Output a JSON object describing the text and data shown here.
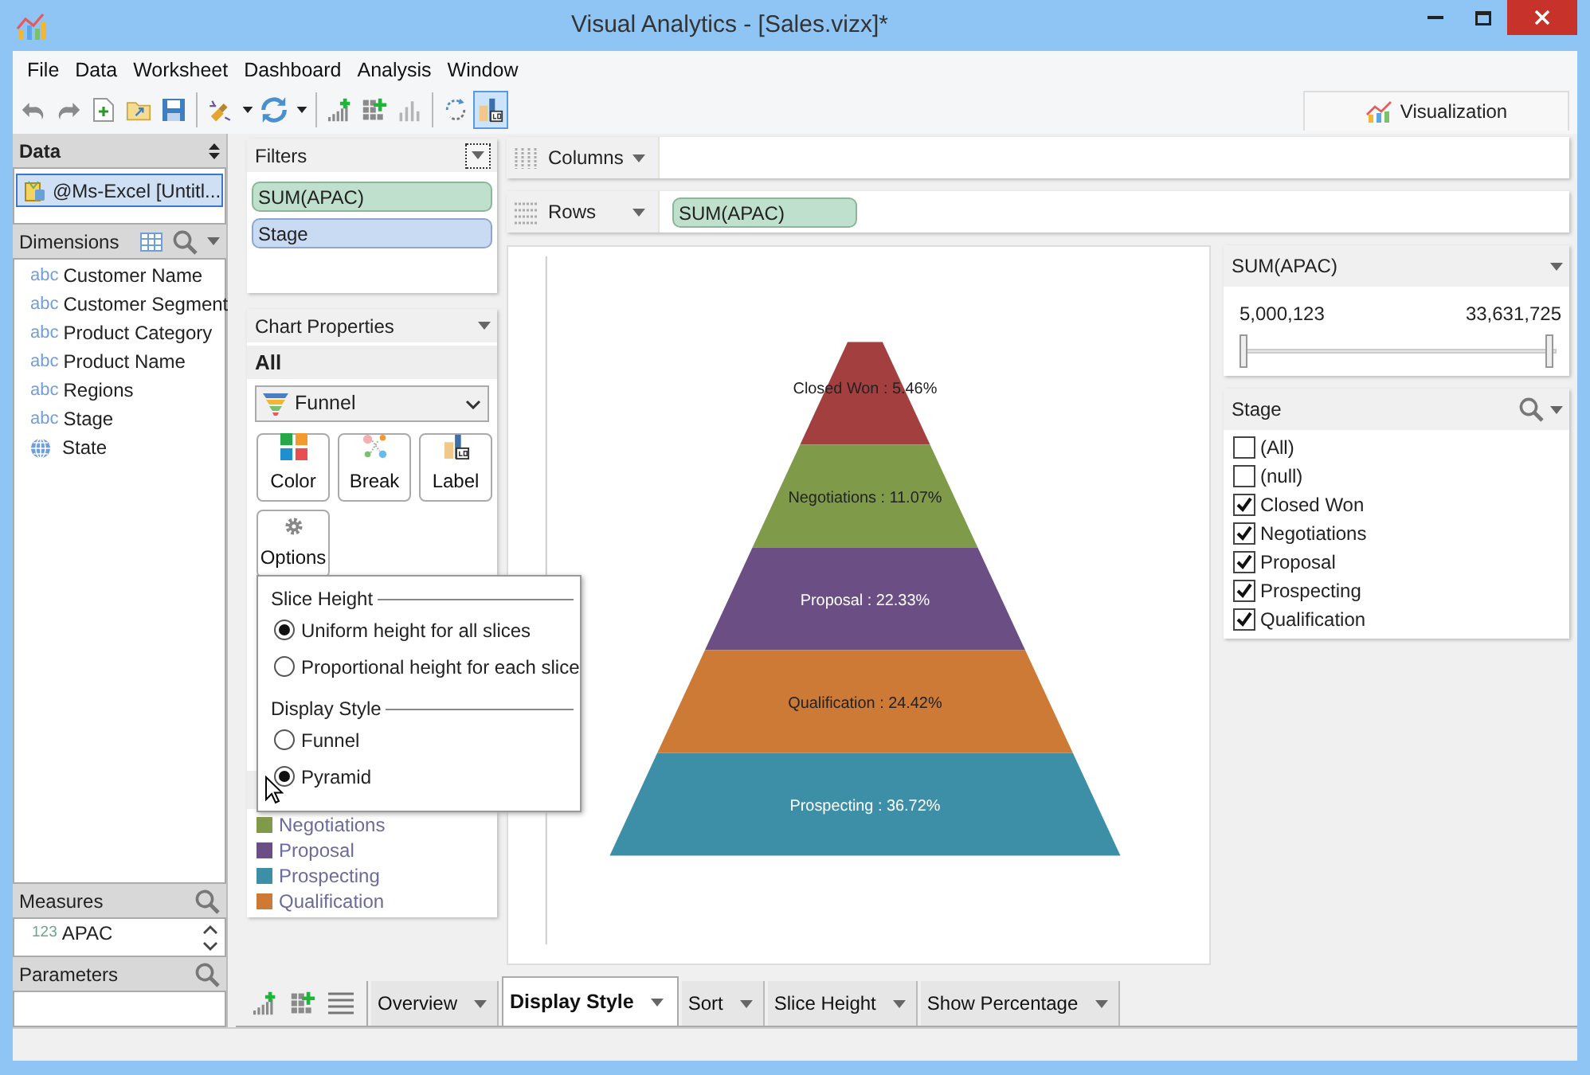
{
  "window": {
    "title": "Visual Analytics - [Sales.vizx]*"
  },
  "menu": [
    "File",
    "Data",
    "Worksheet",
    "Dashboard",
    "Analysis",
    "Window"
  ],
  "toolbar": [
    {
      "kind": "undo",
      "selected": false
    },
    {
      "kind": "redo",
      "selected": false
    },
    {
      "kind": "new",
      "selected": false
    },
    {
      "kind": "open",
      "selected": false
    },
    {
      "kind": "save",
      "selected": false
    },
    {
      "kind": "sep"
    },
    {
      "kind": "connect",
      "selected": false
    },
    {
      "kind": "caret"
    },
    {
      "kind": "refresh",
      "selected": false
    },
    {
      "kind": "caret"
    },
    {
      "kind": "sep"
    },
    {
      "kind": "add-chart",
      "selected": false
    },
    {
      "kind": "add-grid",
      "selected": false
    },
    {
      "kind": "chart",
      "selected": false
    },
    {
      "kind": "sep"
    },
    {
      "kind": "auto-refresh",
      "selected": false
    },
    {
      "kind": "label",
      "selected": true
    }
  ],
  "view_tab": {
    "label": "Visualization"
  },
  "data": {
    "title": "Data",
    "sources": [
      {
        "name": "@Ms-Excel [Untitl...",
        "selected": true
      }
    ]
  },
  "dimensions": {
    "title": "Dimensions",
    "items": [
      {
        "kind": "text",
        "type_label": "abc",
        "name": "Customer Name"
      },
      {
        "kind": "text",
        "type_label": "abc",
        "name": "Customer Segment"
      },
      {
        "kind": "text",
        "type_label": "abc",
        "name": "Product Category"
      },
      {
        "kind": "text",
        "type_label": "abc",
        "name": "Product Name"
      },
      {
        "kind": "text",
        "type_label": "abc",
        "name": "Regions"
      },
      {
        "kind": "text",
        "type_label": "abc",
        "name": "Stage"
      },
      {
        "kind": "geo",
        "name": "State"
      }
    ]
  },
  "measures": {
    "title": "Measures",
    "items": [
      {
        "type_label": "123",
        "name": "APAC"
      }
    ]
  },
  "parameters": {
    "title": "Parameters"
  },
  "filters": {
    "title": "Filters",
    "pills": [
      {
        "label": "SUM(APAC)",
        "kind": "measure"
      },
      {
        "label": "Stage",
        "kind": "dimension"
      }
    ]
  },
  "chart_properties": {
    "title": "Chart Properties",
    "scope": "All",
    "chart_type": "Funnel",
    "buttons": [
      {
        "kind": "color",
        "label": "Color"
      },
      {
        "kind": "break",
        "label": "Break"
      },
      {
        "kind": "label",
        "label": "Label"
      },
      {
        "kind": "options",
        "label": "Options"
      }
    ],
    "legend": [
      {
        "label": "Negotiations",
        "color": "#7f9a48"
      },
      {
        "label": "Proposal",
        "color": "#6b4e84"
      },
      {
        "label": "Prospecting",
        "color": "#3d8fa8"
      },
      {
        "label": "Qualification",
        "color": "#cc7a36"
      }
    ]
  },
  "options_popup": {
    "sections": [
      {
        "title": "Slice Height",
        "options": [
          {
            "label": "Uniform height for all slices",
            "selected": true
          },
          {
            "label": "Proportional height for each slice",
            "selected": false
          }
        ]
      },
      {
        "title": "Display Style",
        "options": [
          {
            "label": "Funnel",
            "selected": false
          },
          {
            "label": "Pyramid",
            "selected": true
          }
        ]
      }
    ]
  },
  "shelves": [
    {
      "label": "Columns",
      "kind": "columns"
    },
    {
      "label": "Rows",
      "kind": "rows",
      "pills": [
        "SUM(APAC)"
      ]
    }
  ],
  "pyramid": {
    "slices": [
      {
        "label": "Closed Won : 5.46%",
        "color": "#a3403f"
      },
      {
        "label": "Negotiations : 11.07%",
        "color": "#7f9a48"
      },
      {
        "label": "Proposal : 22.33%",
        "color": "#6b4e84"
      },
      {
        "label": "Qualification : 24.42%",
        "color": "#cc7a36"
      },
      {
        "label": "Prospecting : 36.72%",
        "color": "#3d8fa8"
      }
    ]
  },
  "range_filter": {
    "title": "SUM(APAC)",
    "min": "5,000,123",
    "max": "33,631,725",
    "thumbs": [
      {
        "level": 0
      },
      {
        "level": 1
      }
    ]
  },
  "stage_filter": {
    "title": "Stage",
    "items": [
      {
        "label": "(All)",
        "checked": false
      },
      {
        "label": "(null)",
        "checked": false
      },
      {
        "label": "Closed Won",
        "checked": true
      },
      {
        "label": "Negotiations",
        "checked": true
      },
      {
        "label": "Proposal",
        "checked": true
      },
      {
        "label": "Prospecting",
        "checked": true
      },
      {
        "label": "Qualification",
        "checked": true
      }
    ]
  },
  "bottom_tabs": [
    {
      "label": "Overview",
      "selected": false
    },
    {
      "label": "Display Style",
      "selected": true
    },
    {
      "label": "Sort",
      "selected": false
    },
    {
      "label": "Slice Height",
      "selected": false
    },
    {
      "label": "Show Percentage",
      "selected": false
    }
  ]
}
